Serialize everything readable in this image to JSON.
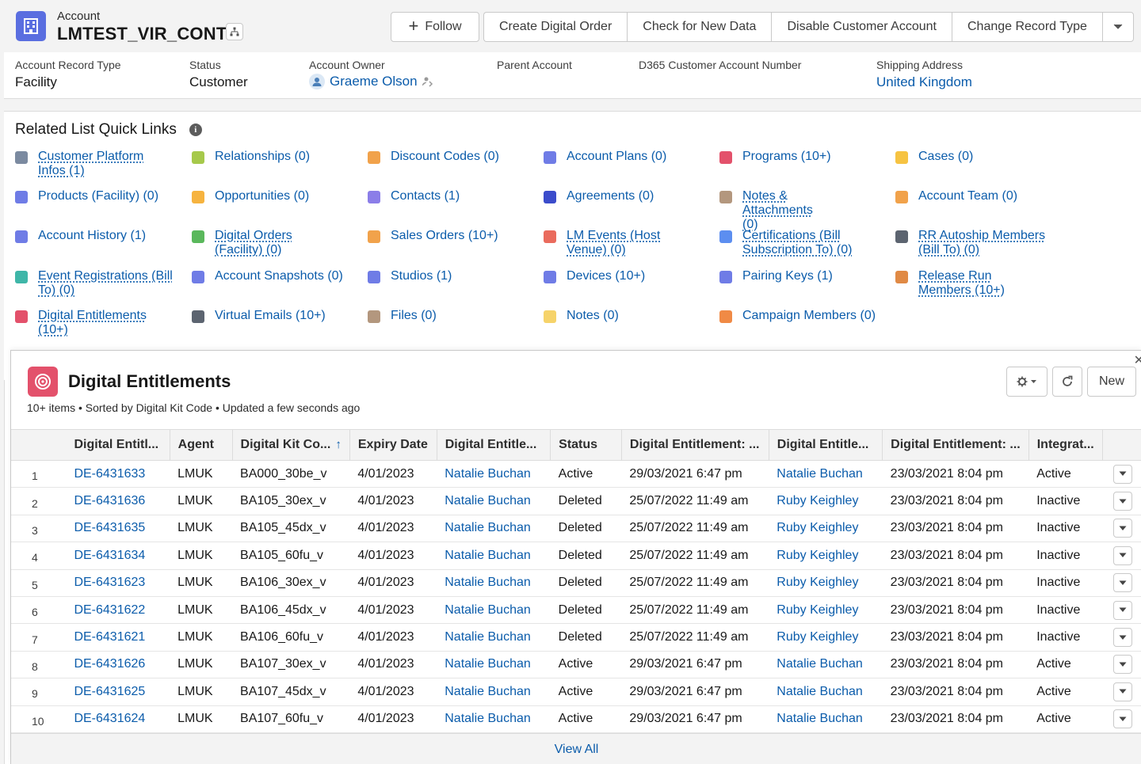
{
  "header": {
    "object_label": "Account",
    "record_name": "LMTEST_VIR_CONT",
    "actions": {
      "follow": "Follow",
      "create_digital_order": "Create Digital Order",
      "check_new_data": "Check for New Data",
      "disable_account": "Disable Customer Account",
      "change_record_type": "Change Record Type"
    },
    "fields": {
      "record_type_label": "Account Record Type",
      "record_type_value": "Facility",
      "status_label": "Status",
      "status_value": "Customer",
      "owner_label": "Account Owner",
      "owner_value": "Graeme Olson",
      "parent_label": "Parent Account",
      "d365_label": "D365 Customer Account Number",
      "shipping_label": "Shipping Address",
      "shipping_value": "United Kingdom"
    }
  },
  "quick_links": {
    "title": "Related List Quick Links",
    "items": [
      {
        "label": "Customer Platform Infos (1)",
        "color": "#7b8aa0"
      },
      {
        "label": "Relationships (0)",
        "color": "#a6c94b"
      },
      {
        "label": "Discount Codes (0)",
        "color": "#f1a24b"
      },
      {
        "label": "Account Plans (0)",
        "color": "#6f7ce6"
      },
      {
        "label": "Programs (10+)",
        "color": "#e3516b"
      },
      {
        "label": "Cases (0)",
        "color": "#f6c342"
      },
      {
        "label": "Products (Facility) (0)",
        "color": "#6f7ce6"
      },
      {
        "label": "Opportunities (0)",
        "color": "#f6b33f"
      },
      {
        "label": "Contacts (1)",
        "color": "#8b7ee8"
      },
      {
        "label": "Agreements (0)",
        "color": "#3b4ccb"
      },
      {
        "label": "Notes & Attachments (0)",
        "color": "#b3977e"
      },
      {
        "label": "Account Team (0)",
        "color": "#f1a24b"
      },
      {
        "label": "Account History (1)",
        "color": "#6f7ce6"
      },
      {
        "label": "Digital Orders (Facility) (0)",
        "color": "#5ab85c"
      },
      {
        "label": "Sales Orders (10+)",
        "color": "#f1a24b"
      },
      {
        "label": "LM Events (Host Venue) (0)",
        "color": "#ea6b5d"
      },
      {
        "label": "Certifications (Bill Subscription To) (0)",
        "color": "#5c8ef0"
      },
      {
        "label": "RR Autoship Members (Bill To) (0)",
        "color": "#5c6470"
      },
      {
        "label": "Event Registrations (Bill To) (0)",
        "color": "#3fb6a8"
      },
      {
        "label": "Account Snapshots (0)",
        "color": "#6f7ce6"
      },
      {
        "label": "Studios (1)",
        "color": "#6f7ce6"
      },
      {
        "label": "Devices (10+)",
        "color": "#6f7ce6"
      },
      {
        "label": "Pairing Keys (1)",
        "color": "#6f7ce6"
      },
      {
        "label": "Release Run Members (10+)",
        "color": "#e08a45"
      },
      {
        "label": "Digital Entitlements (10+)",
        "color": "#e3516b"
      },
      {
        "label": "Virtual Emails (10+)",
        "color": "#5c6470"
      },
      {
        "label": "Files (0)",
        "color": "#b3977e"
      },
      {
        "label": "Notes (0)",
        "color": "#f6d36a"
      },
      {
        "label": "Campaign Members (0)",
        "color": "#f08a45"
      }
    ]
  },
  "related_list": {
    "title": "Digital Entitlements",
    "subtitle": "10+ items • Sorted by Digital Kit Code • Updated a few seconds ago",
    "new_button": "New",
    "view_all": "View All",
    "columns": [
      "Digital Entitl...",
      "Agent",
      "Digital Kit Co...",
      "Expiry Date",
      "Digital Entitle...",
      "Status",
      "Digital Entitlement: ...",
      "Digital Entitle...",
      "Digital Entitlement: ...",
      "Integrat..."
    ],
    "rows": [
      [
        "1",
        "DE-6431633",
        "LMUK",
        "BA000_30be_v",
        "4/01/2023",
        "Natalie Buchan",
        "Active",
        "29/03/2021 6:47 pm",
        "Natalie Buchan",
        "23/03/2021 8:04 pm",
        "Active"
      ],
      [
        "2",
        "DE-6431636",
        "LMUK",
        "BA105_30ex_v",
        "4/01/2023",
        "Natalie Buchan",
        "Deleted",
        "25/07/2022 11:49 am",
        "Ruby Keighley",
        "23/03/2021 8:04 pm",
        "Inactive"
      ],
      [
        "3",
        "DE-6431635",
        "LMUK",
        "BA105_45dx_v",
        "4/01/2023",
        "Natalie Buchan",
        "Deleted",
        "25/07/2022 11:49 am",
        "Ruby Keighley",
        "23/03/2021 8:04 pm",
        "Inactive"
      ],
      [
        "4",
        "DE-6431634",
        "LMUK",
        "BA105_60fu_v",
        "4/01/2023",
        "Natalie Buchan",
        "Deleted",
        "25/07/2022 11:49 am",
        "Ruby Keighley",
        "23/03/2021 8:04 pm",
        "Inactive"
      ],
      [
        "5",
        "DE-6431623",
        "LMUK",
        "BA106_30ex_v",
        "4/01/2023",
        "Natalie Buchan",
        "Deleted",
        "25/07/2022 11:49 am",
        "Ruby Keighley",
        "23/03/2021 8:04 pm",
        "Inactive"
      ],
      [
        "6",
        "DE-6431622",
        "LMUK",
        "BA106_45dx_v",
        "4/01/2023",
        "Natalie Buchan",
        "Deleted",
        "25/07/2022 11:49 am",
        "Ruby Keighley",
        "23/03/2021 8:04 pm",
        "Inactive"
      ],
      [
        "7",
        "DE-6431621",
        "LMUK",
        "BA106_60fu_v",
        "4/01/2023",
        "Natalie Buchan",
        "Deleted",
        "25/07/2022 11:49 am",
        "Ruby Keighley",
        "23/03/2021 8:04 pm",
        "Inactive"
      ],
      [
        "8",
        "DE-6431626",
        "LMUK",
        "BA107_30ex_v",
        "4/01/2023",
        "Natalie Buchan",
        "Active",
        "29/03/2021 6:47 pm",
        "Natalie Buchan",
        "23/03/2021 8:04 pm",
        "Active"
      ],
      [
        "9",
        "DE-6431625",
        "LMUK",
        "BA107_45dx_v",
        "4/01/2023",
        "Natalie Buchan",
        "Active",
        "29/03/2021 6:47 pm",
        "Natalie Buchan",
        "23/03/2021 8:04 pm",
        "Active"
      ],
      [
        "10",
        "DE-6431624",
        "LMUK",
        "BA107_60fu_v",
        "4/01/2023",
        "Natalie Buchan",
        "Active",
        "29/03/2021 6:47 pm",
        "Natalie Buchan",
        "23/03/2021 8:04 pm",
        "Active"
      ]
    ]
  },
  "colors": {
    "link": "#0b5cab",
    "account_icon": "#5a6ee0",
    "entitlement_icon": "#e3516b"
  }
}
